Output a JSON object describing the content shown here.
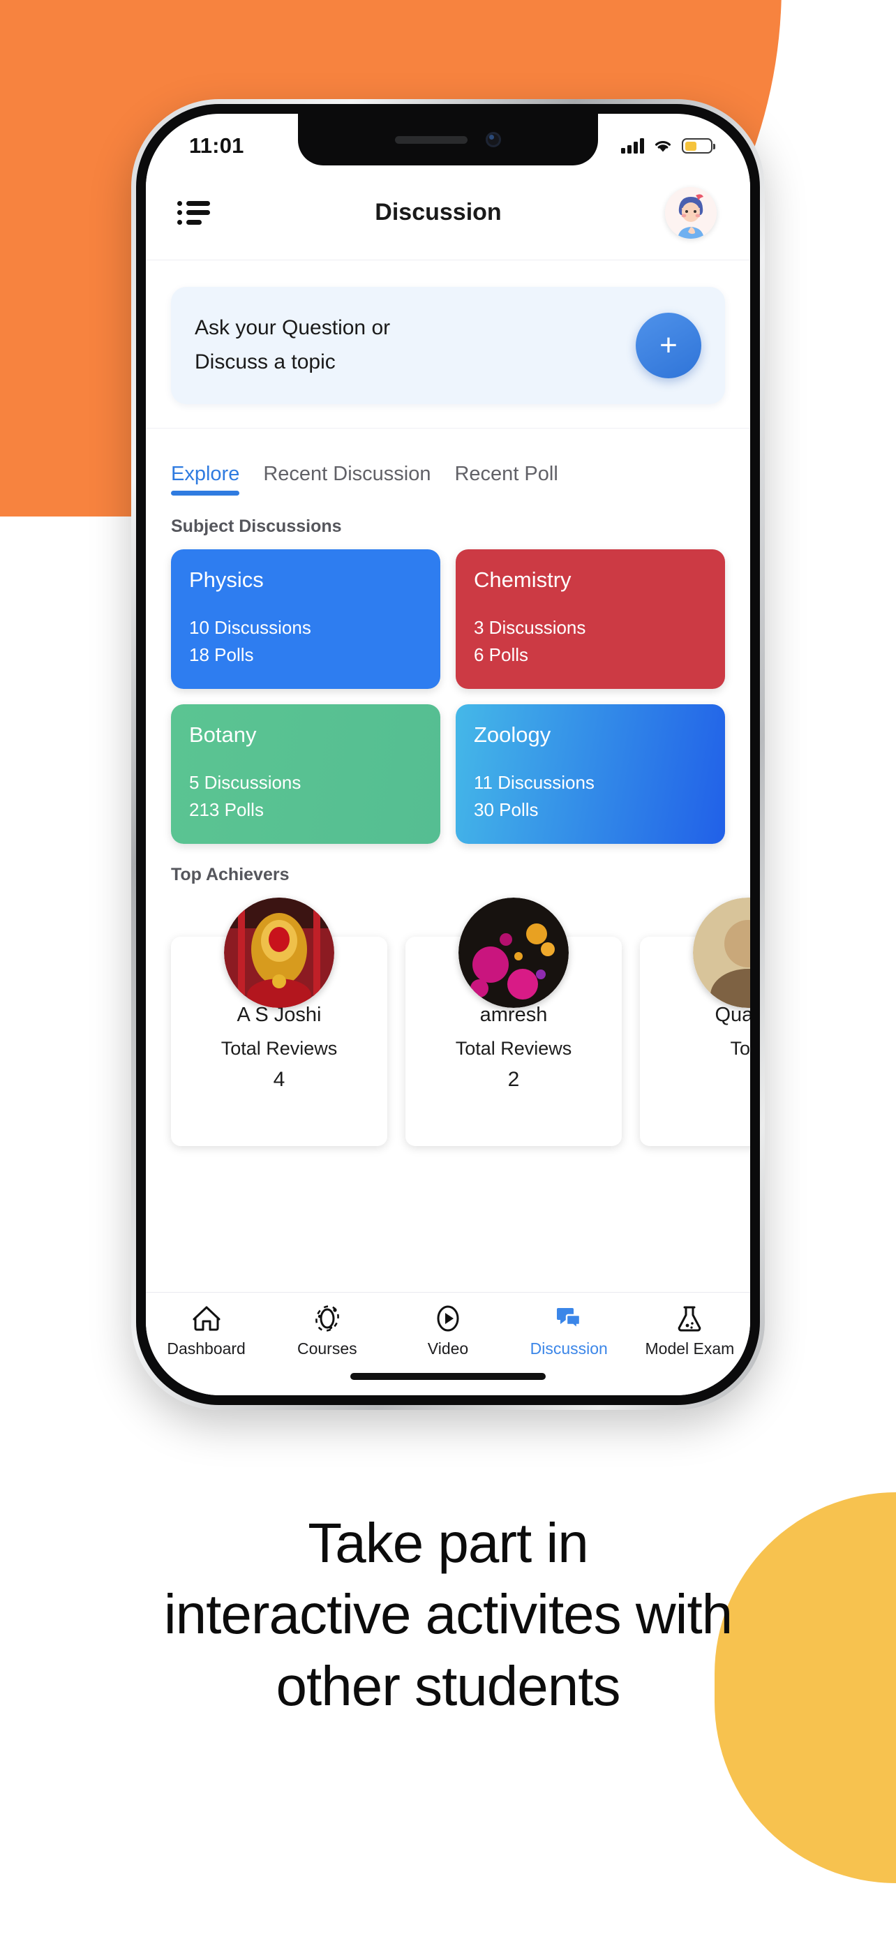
{
  "theme": {
    "orange": "#F7833F",
    "yellow": "#F7C24F",
    "accent_blue": "#2F7BE0",
    "card_bg": "#EEF5FD"
  },
  "statusbar": {
    "time": "11:01",
    "signal_icon": "cellular-signal-icon",
    "wifi_icon": "wifi-icon",
    "battery_icon": "battery-icon"
  },
  "header": {
    "menu_icon": "hamburger-menu-icon",
    "title": "Discussion",
    "avatar_icon": "user-avatar"
  },
  "ask": {
    "line1": "Ask your Question or",
    "line2": "Discuss a topic",
    "fab_label": "+",
    "fab_icon": "plus-icon"
  },
  "tabs": [
    {
      "label": "Explore",
      "active": true
    },
    {
      "label": "Recent Discussion",
      "active": false
    },
    {
      "label": "Recent Poll",
      "active": false
    }
  ],
  "subjects": {
    "title": "Subject Discussions",
    "items": [
      {
        "name": "Physics",
        "discussions": "10 Discussions",
        "polls": "18 Polls",
        "color": "#2E7DF0",
        "color2": "#2E7DF0"
      },
      {
        "name": "Chemistry",
        "discussions": "3 Discussions",
        "polls": "6 Polls",
        "color": "#CC3A44",
        "color2": "#CC3A44"
      },
      {
        "name": "Botany",
        "discussions": "5 Discussions",
        "polls": "213 Polls",
        "color": "#5BC492",
        "color2": "#55BE92"
      },
      {
        "name": "Zoology",
        "discussions": "11 Discussions",
        "polls": "30 Polls",
        "color": "#45B8E8",
        "color2": "#2160E8"
      }
    ]
  },
  "achievers": {
    "title": "Top Achievers",
    "reviews_label": "Total Reviews",
    "items": [
      {
        "name": "A S Joshi",
        "label": "Total Reviews",
        "count": "4"
      },
      {
        "name": "amresh",
        "label": "Total Reviews",
        "count": "2"
      },
      {
        "name": "Quarint",
        "label": "Tota",
        "count": ""
      }
    ]
  },
  "bottom_nav": [
    {
      "label": "Dashboard",
      "icon": "home-icon",
      "active": false
    },
    {
      "label": "Courses",
      "icon": "atom-icon",
      "active": false
    },
    {
      "label": "Video",
      "icon": "play-icon",
      "active": false
    },
    {
      "label": "Discussion",
      "icon": "chat-bubbles-icon",
      "active": true
    },
    {
      "label": "Model Exam",
      "icon": "flask-icon",
      "active": false
    }
  ],
  "caption": {
    "line1": "Take part in",
    "line2": "interactive activites with",
    "line3": "other students"
  }
}
